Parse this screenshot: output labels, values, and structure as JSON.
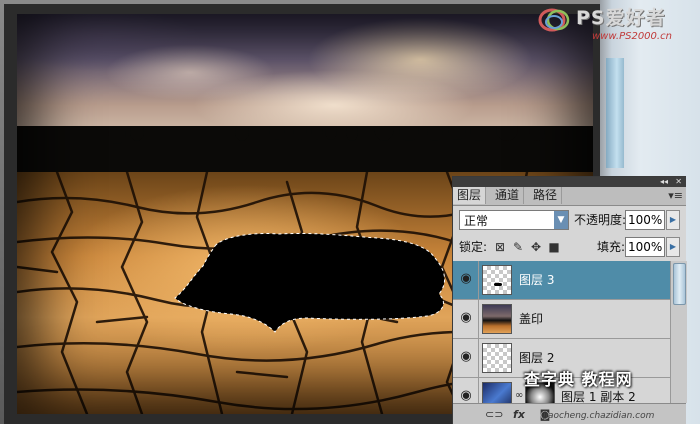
{
  "watermark_top": {
    "brand": "PS爱好者",
    "url": "www.PS2000.cn"
  },
  "layers_panel": {
    "tabs": [
      "图层",
      "通道",
      "路径"
    ],
    "blend_mode": "正常",
    "opacity_label": "不透明度:",
    "opacity_value": "100%",
    "lock_label": "锁定:",
    "fill_label": "填充:",
    "fill_value": "100%",
    "layers": [
      {
        "name": "图层 3",
        "selected": true,
        "visible": true
      },
      {
        "name": "盖印",
        "selected": false,
        "visible": true
      },
      {
        "name": "图层 2",
        "selected": false,
        "visible": true
      },
      {
        "name": "图层 1 副本 2",
        "selected": false,
        "visible": true
      }
    ],
    "bottom_site": "jiaocheng.chazidian.com"
  },
  "watermark_bottom": {
    "text": "查字典 教程网"
  },
  "icons": {
    "eye": "eye-icon",
    "collapse": "double-arrow-icon",
    "close": "close-icon",
    "menu": "panel-menu-icon",
    "lock_transparent": "lock-transparent-icon",
    "lock_paint": "brush-icon",
    "lock_move": "move-icon",
    "lock_all": "lock-icon",
    "link": "link-icon",
    "fx": "fx-icon",
    "mask": "mask-icon"
  }
}
